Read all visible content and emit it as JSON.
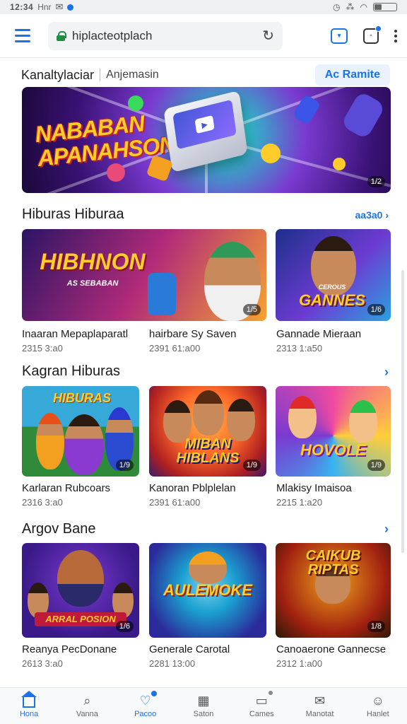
{
  "status_bar": {
    "time": "12:34",
    "carrier": "Hnr"
  },
  "browser": {
    "url": "hiplacteotplach"
  },
  "header": {
    "title": "Kanaltylaciar",
    "subtitle": "Anjemasin",
    "button_label": "Ac Ramite"
  },
  "hero": {
    "title_line1": "NABABAN",
    "title_line2": "APANAHSON",
    "badge": "1/2"
  },
  "sections": [
    {
      "title": "Hiburas Hiburaa",
      "link": "aa3a0",
      "cards": [
        {
          "art": "HIBHNON",
          "art_sub": "AS SEBABAN",
          "title": "Inaaran Mepaplaparatl",
          "meta": "2315 3:a0",
          "badge": "1/5",
          "colors": [
            "#2c1464",
            "#b02a7a",
            "#f7a230"
          ]
        },
        {
          "art": "",
          "title": "hairbare Sy Saven",
          "meta": "2391 61:a00",
          "badge": "",
          "colors": [
            "#ffb347",
            "#d64a8e",
            "#4a2a9a"
          ]
        },
        {
          "art": "GANNES",
          "art_sub": "CEROUS",
          "title": "Gannade Mieraan",
          "meta": "2313 1:a50",
          "badge": "1/6",
          "colors": [
            "#1e2f8a",
            "#6c3bd2",
            "#2aa2e0"
          ]
        }
      ]
    },
    {
      "title": "Kagran Hiburas",
      "link": "",
      "cards": [
        {
          "art": "HIBURAS",
          "art_sub": "",
          "title": "Karlaran Rubcoars",
          "meta": "2316 3:a0",
          "badge": "1/9",
          "colors": [
            "#36a9d8",
            "#2f8a3a",
            "#f5c13a"
          ]
        },
        {
          "art": "MIBAN HIBLANS",
          "art_sub": "",
          "title": "Kanoran Pblplelan",
          "meta": "2391 61:a00",
          "badge": "1/9",
          "colors": [
            "#ff6a2a",
            "#b02020",
            "#3a1a6a"
          ]
        },
        {
          "art": "HOVOLE",
          "art_sub": "",
          "title": "Mlakisy Imaisoa",
          "meta": "2215 1:a20",
          "badge": "1/9",
          "colors": [
            "#f04aa0",
            "#ffce3a",
            "#37b4f0"
          ]
        }
      ]
    },
    {
      "title": "Argov Bane",
      "link": "",
      "cards": [
        {
          "art": "ARRAL POSION",
          "art_sub": "",
          "title": "Reanya PecDonane",
          "meta": "2613 3:a0",
          "badge": "1/6",
          "colors": [
            "#3a1a8a",
            "#c01a3a",
            "#f6a21a"
          ]
        },
        {
          "art": "AULEMOKE",
          "art_sub": "",
          "title": "Generale Carotal",
          "meta": "2281 13:00",
          "badge": "",
          "colors": [
            "#1aa0d0",
            "#2a2a9a",
            "#f5c13a"
          ]
        },
        {
          "art": "CAIKUB RIPTAS",
          "art_sub": "",
          "title": "Canoaerone Gannecse",
          "meta": "2312 1:a00",
          "badge": "1/8",
          "colors": [
            "#f0a21a",
            "#a02010",
            "#2a1a0a"
          ]
        }
      ]
    }
  ],
  "bottom_nav": [
    {
      "label": "Hona",
      "icon": "home-icon",
      "active": true
    },
    {
      "label": "Vanna",
      "icon": "search-icon",
      "active": false
    },
    {
      "label": "Pacoo",
      "icon": "heart-icon",
      "active": true
    },
    {
      "label": "Saton",
      "icon": "grid-icon",
      "active": false
    },
    {
      "label": "Cames",
      "icon": "chat-icon",
      "active": false
    },
    {
      "label": "Manotat",
      "icon": "inbox-icon",
      "active": false
    },
    {
      "label": "Hanlet",
      "icon": "profile-icon",
      "active": false
    }
  ],
  "colors": {
    "accent": "#1a73e8"
  }
}
